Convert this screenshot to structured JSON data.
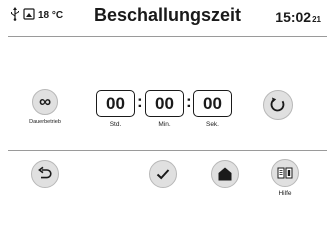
{
  "header": {
    "temperature": "18 °C",
    "title": "Beschallungszeit",
    "time_main": "15:02",
    "time_seconds": "21",
    "icons": [
      "usb-icon",
      "display-icon"
    ]
  },
  "continuous": {
    "label": "Dauerbetrieb",
    "symbol": "∞"
  },
  "timer": {
    "hours": "00",
    "minutes": "00",
    "seconds": "00",
    "hours_label": "Std.",
    "minutes_label": "Min.",
    "seconds_label": "Sek.",
    "separator": ":"
  },
  "footer": {
    "help_label": "Hilfe",
    "icons": [
      "back-icon",
      "confirm-icon",
      "home-icon",
      "help-icon"
    ]
  },
  "colors": {
    "button_bg": "#e0e0e0",
    "text": "#1a1a1a",
    "divider": "#9a9a9a"
  }
}
